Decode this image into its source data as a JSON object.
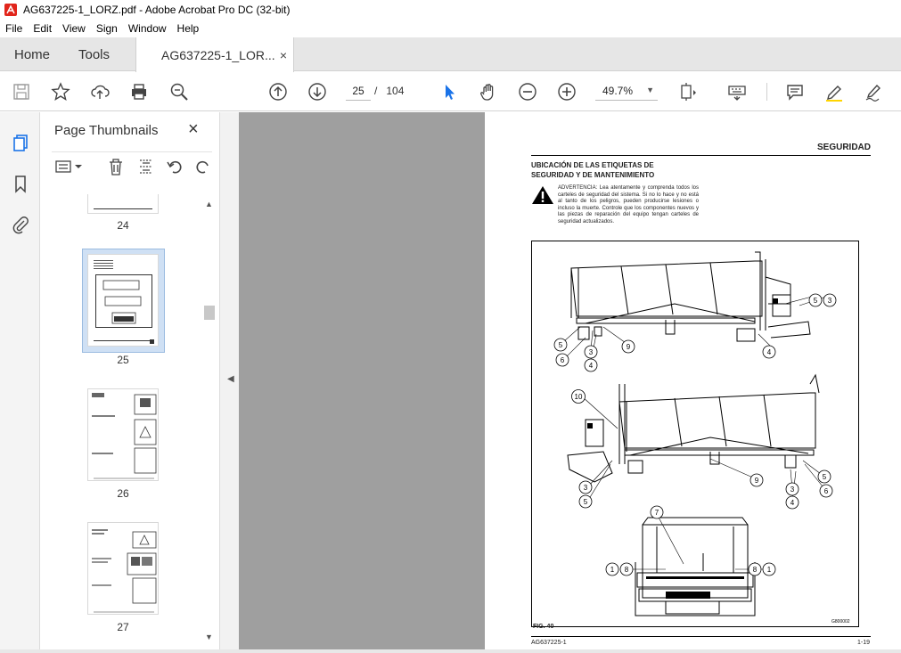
{
  "window": {
    "title": "AG637225-1_LORZ.pdf - Adobe Acrobat Pro DC (32-bit)"
  },
  "menu": [
    "File",
    "Edit",
    "View",
    "Sign",
    "Window",
    "Help"
  ],
  "tabs": {
    "home": "Home",
    "tools": "Tools",
    "document": "AG637225-1_LOR...",
    "close": "×"
  },
  "toolbar": {
    "current_page": "25",
    "page_separator": "/",
    "total_pages": "104",
    "zoom": "49.7%"
  },
  "thumbnails_panel": {
    "title": "Page Thumbnails",
    "close": "×",
    "pages": [
      {
        "label": "24"
      },
      {
        "label": "25",
        "selected": true
      },
      {
        "label": "26"
      },
      {
        "label": "27"
      }
    ]
  },
  "pdf_page": {
    "header": "SEGURIDAD",
    "section_title_line1": "UBICACIÓN DE LAS ETIQUETAS DE",
    "section_title_line2": "SEGURIDAD Y DE MANTENIMIENTO",
    "warning_text": "ADVERTENCIA: Lea atentamente y comprenda todos los carteles de seguridad del sistema. Si no lo hace y no está al tanto de los peligros, pueden producirse lesiones o incluso la muerte. Controle que los componentes nuevos y las piezas de reparación del equipo tengan carteles de seguridad actualizados.",
    "figure_label": "FIG. 40",
    "figure_code": "G800002",
    "callouts_top": [
      "5",
      "6",
      "3",
      "4",
      "9",
      "4",
      "5",
      "3"
    ],
    "callouts_mid": [
      "10",
      "3",
      "5",
      "9",
      "3",
      "4",
      "5",
      "6"
    ],
    "callouts_bottom": [
      "7",
      "1",
      "8",
      "8",
      "1"
    ],
    "footer_left": "AG637225-1",
    "footer_right": "1-19"
  },
  "colors": {
    "document_bg": "#9f9f9f",
    "accent_blue": "#1a73e8"
  }
}
